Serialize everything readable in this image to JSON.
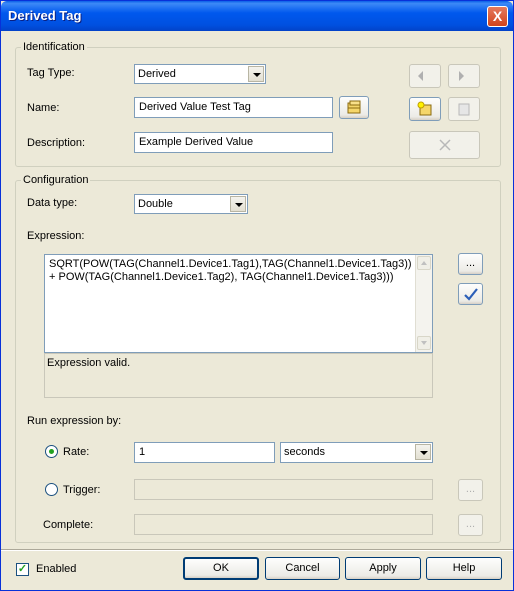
{
  "window": {
    "title": "Derived Tag",
    "close": "X"
  },
  "identification": {
    "group_title": "Identification",
    "tag_type_label": "Tag Type:",
    "tag_type_value": "Derived",
    "name_label": "Name:",
    "name_value": "Derived Value Test Tag",
    "description_label": "Description:",
    "description_value": "Example Derived Value"
  },
  "configuration": {
    "group_title": "Configuration",
    "data_type_label": "Data type:",
    "data_type_value": "Double",
    "expression_label": "Expression:",
    "expression_lines": [
      "SQRT(POW(TAG(Channel1.Device1.Tag1),TAG(Channel1.Device1.Tag3))",
      "+ POW(TAG(Channel1.Device1.Tag2), TAG(Channel1.Device1.Tag3)))"
    ],
    "expression_browse": "...",
    "expression_status": "Expression valid.",
    "run_by_label": "Run expression by:",
    "rate_label": "Rate:",
    "rate_value": "1",
    "rate_unit": "seconds",
    "trigger_label": "Trigger:",
    "trigger_browse": "...",
    "complete_label": "Complete:",
    "complete_browse": "..."
  },
  "footer": {
    "enabled_label": "Enabled",
    "ok": "OK",
    "cancel": "Cancel",
    "apply": "Apply",
    "help": "Help"
  }
}
